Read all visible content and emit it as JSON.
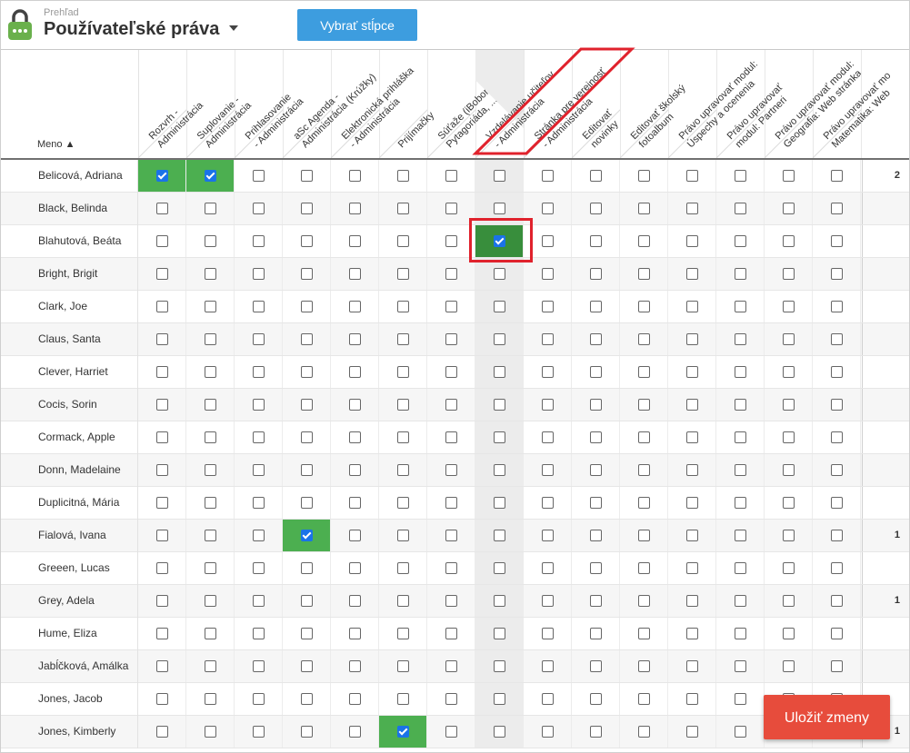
{
  "header": {
    "breadcrumb": "Prehľad",
    "title": "Používateľské práva",
    "select_columns_label": "Vybrať stĺpce"
  },
  "table": {
    "name_header": "Meno ▲",
    "columns": [
      "Rozvrh -\nAdministrácia",
      "Suplovanie -\nAdministrácia",
      "Prihlasovanie\n- Administrácia",
      "aSc Agenda -\nAdministrácia (Krúžky)",
      "Elektronická prihláška\n- Administrácia",
      "Prijímačky",
      "Súťaže (iBobor,\nPytagoriáda, ...)",
      "Vzdelávanie učiteľov\n- Administrácia",
      "Stránka pre verejnosť\n- Administrácia",
      "Editovať\nnovinky",
      "Editovať školský\nfotoalbum",
      "Právo upravovať modul:\nÚspechy a ocenenia",
      "Právo upravovať\nmodul: Partneri",
      "Právo upravovať modul:\nGeografia: Web stránka",
      "Právo upravovať mo\nMatematika: Web"
    ],
    "highlighted_column": 7,
    "rows": [
      {
        "name": "Belicová, Adriana",
        "checked": [
          0,
          1
        ],
        "count": "2"
      },
      {
        "name": "Black, Belinda",
        "checked": [],
        "count": ""
      },
      {
        "name": "Blahutová, Beáta",
        "checked": [
          7
        ],
        "count": ""
      },
      {
        "name": "Bright, Brigit",
        "checked": [],
        "count": ""
      },
      {
        "name": "Clark, Joe",
        "checked": [],
        "count": ""
      },
      {
        "name": "Claus, Santa",
        "checked": [],
        "count": ""
      },
      {
        "name": "Clever, Harriet",
        "checked": [],
        "count": ""
      },
      {
        "name": "Cocis, Sorin",
        "checked": [],
        "count": ""
      },
      {
        "name": "Cormack, Apple",
        "checked": [],
        "count": ""
      },
      {
        "name": "Donn, Madelaine",
        "checked": [],
        "count": ""
      },
      {
        "name": "Duplicitná, Mária",
        "checked": [],
        "count": ""
      },
      {
        "name": "Fialová, Ivana",
        "checked": [
          3
        ],
        "count": "1"
      },
      {
        "name": "Greeen, Lucas",
        "checked": [],
        "count": ""
      },
      {
        "name": "Grey, Adela",
        "checked": [],
        "count": "1"
      },
      {
        "name": "Hume, Eliza",
        "checked": [],
        "count": ""
      },
      {
        "name": "Jabĺčková, Amálka",
        "checked": [],
        "count": ""
      },
      {
        "name": "Jones, Jacob",
        "checked": [],
        "count": ""
      },
      {
        "name": "Jones, Kimberly",
        "checked": [
          5
        ],
        "count": "1"
      }
    ]
  },
  "save_label": "Uložiť zmeny",
  "colors": {
    "accent_blue": "#3d9ddf",
    "checked_green": "#4caf50",
    "save_red": "#e74c3c",
    "annotation_red": "#e0222c",
    "app_icon_green": "#6ab04c"
  },
  "icons": {
    "app": "lock-icon",
    "caret": "caret-down-icon"
  }
}
